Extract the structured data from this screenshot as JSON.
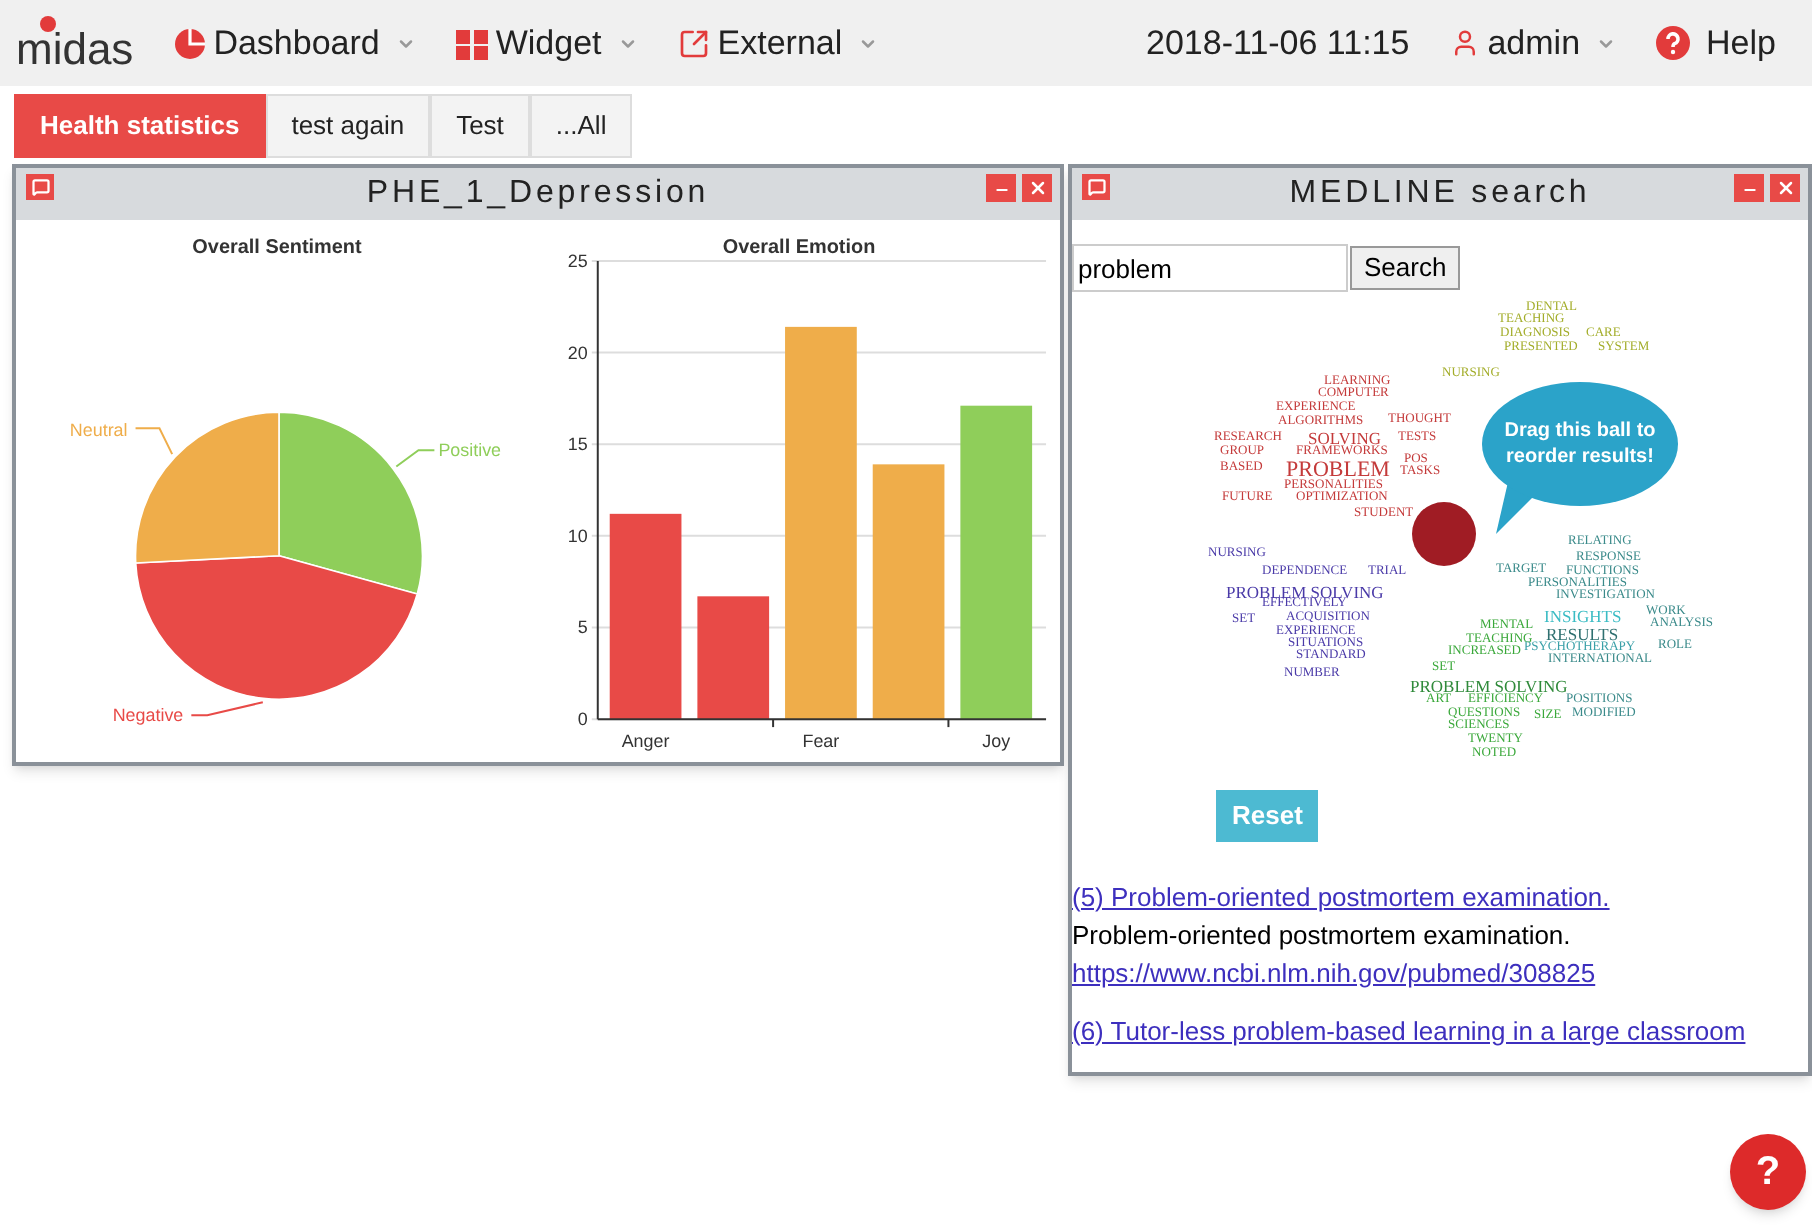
{
  "navbar": {
    "logo": "midas",
    "menus": [
      {
        "label": "Dashboard",
        "kind": "pie"
      },
      {
        "label": "Widget",
        "kind": "grid"
      },
      {
        "label": "External",
        "kind": "external"
      }
    ],
    "datetime": "2018-11-06 11:15",
    "user": "admin",
    "help": "Help"
  },
  "tabs": [
    {
      "label": "Health statistics",
      "selected": true
    },
    {
      "label": "test again",
      "selected": false
    },
    {
      "label": "Test",
      "selected": false
    },
    {
      "label": "...All",
      "selected": false
    }
  ],
  "windows": [
    {
      "title": "PHE_1_Depression",
      "kind": "charts",
      "pie": {
        "chart_data": {
          "type": "pie",
          "title": "Overall Sentiment",
          "categories": [
            "Positive",
            "Negative",
            "Neutral"
          ],
          "series": [
            {
              "values": [
                29.3,
                44.9,
                25.8
              ]
            }
          ],
          "colors": [
            "#8fce5a",
            "#e84a47",
            "#efad4a"
          ]
        }
      },
      "bar": {
        "chart_data": {
          "type": "bar",
          "title": "Overall Emotion",
          "categories": [
            "Anger",
            null,
            "Fear",
            null,
            "Joy"
          ],
          "series": [
            {
              "values": [
                11.2,
                6.7,
                21.4,
                13.9,
                17.1
              ]
            }
          ],
          "grid": true,
          "colors": [
            "#e84a47",
            "#e84a47",
            "#efad4a",
            "#efad4a",
            "#8fce5a"
          ],
          "ylim": [
            0,
            25
          ],
          "yticks": [
            0,
            5,
            10,
            15,
            20,
            25
          ]
        }
      }
    },
    {
      "title": "MEDLINE search",
      "kind": "search",
      "search": {
        "value": "problem",
        "button": "Search"
      },
      "tip": "Drag this ball to reorder results!",
      "words": [
        {
          "text": "DENTAL",
          "color": "#a3ad2a"
        },
        {
          "text": "TEACHING",
          "color": "#a3ad2a"
        },
        {
          "text": "DIAGNOSIS",
          "color": "#a3ad2a"
        },
        {
          "text": "CARE",
          "color": "#a3ad2a"
        },
        {
          "text": "PRESENTED",
          "color": "#a3ad2a"
        },
        {
          "text": "SYSTEM",
          "color": "#a3ad2a"
        },
        {
          "text": "NURSING",
          "color": "#a3ad2a"
        },
        {
          "text": "LEARNING",
          "color": "#c43a3a"
        },
        {
          "text": "COMPUTER",
          "color": "#c43a3a"
        },
        {
          "text": "EXPERIENCE",
          "color": "#c43a3a"
        },
        {
          "text": "ALGORITHMS",
          "color": "#c43a3a"
        },
        {
          "text": "THOUGHT",
          "color": "#c43a3a"
        },
        {
          "text": "RESEARCH",
          "color": "#c43a3a"
        },
        {
          "text": "SOLVING",
          "color": "#c43a3a",
          "kind": "medium"
        },
        {
          "text": "TESTS",
          "color": "#c43a3a"
        },
        {
          "text": "GROUP",
          "color": "#c43a3a"
        },
        {
          "text": "FRAMEWORKS",
          "color": "#c43a3a"
        },
        {
          "text": "POS",
          "color": "#c43a3a"
        },
        {
          "text": "BASED",
          "color": "#c43a3a"
        },
        {
          "text": "PROBLEM",
          "color": "#c43a3a",
          "kind": "large"
        },
        {
          "text": "TASKS",
          "color": "#c43a3a"
        },
        {
          "text": "PERSONALITIES",
          "color": "#c43a3a"
        },
        {
          "text": "FUTURE",
          "color": "#c43a3a"
        },
        {
          "text": "OPTIMIZATION",
          "color": "#c43a3a"
        },
        {
          "text": "STUDENT",
          "color": "#c43a3a"
        },
        {
          "text": "NURSING",
          "color": "#4a3aa8"
        },
        {
          "text": "DEPENDENCE",
          "color": "#4a3aa8"
        },
        {
          "text": "TRIAL",
          "color": "#4a3aa8"
        },
        {
          "text": "PROBLEM SOLVING",
          "color": "#4a3aa8",
          "kind": "medium"
        },
        {
          "text": "EFFECTIVELY",
          "color": "#4a3aa8"
        },
        {
          "text": "SET",
          "color": "#4a3aa8"
        },
        {
          "text": "ACQUISITION",
          "color": "#4a3aa8"
        },
        {
          "text": "EXPERIENCE",
          "color": "#4a3aa8"
        },
        {
          "text": "SITUATIONS",
          "color": "#4a3aa8"
        },
        {
          "text": "STANDARD",
          "color": "#4a3aa8"
        },
        {
          "text": "NUMBER",
          "color": "#4a3aa8"
        },
        {
          "text": "RELATING",
          "color": "#3a8a8a"
        },
        {
          "text": "RESPONSE",
          "color": "#3a8a8a"
        },
        {
          "text": "TARGET",
          "color": "#3a8a8a"
        },
        {
          "text": "FUNCTIONS",
          "color": "#3a8a8a"
        },
        {
          "text": "PERSONALITIES",
          "color": "#3a8a8a"
        },
        {
          "text": "INVESTIGATION",
          "color": "#3a8a8a"
        },
        {
          "text": "INSIGHTS",
          "color": "#3bbcc4",
          "kind": "medium"
        },
        {
          "text": "WORK",
          "color": "#3a8a8a"
        },
        {
          "text": "ANALYSIS",
          "color": "#3a8a8a"
        },
        {
          "text": "RESULTS",
          "color": "#2f7070",
          "kind": "medium"
        },
        {
          "text": "PSYCHOTHERAPY",
          "color": "#3aa0a8"
        },
        {
          "text": "ROLE",
          "color": "#3a8a8a"
        },
        {
          "text": "INTERNATIONAL",
          "color": "#3a8a8a"
        },
        {
          "text": "POSITIONS",
          "color": "#3a8a8a"
        },
        {
          "text": "MODIFIED",
          "color": "#3a8a8a"
        },
        {
          "text": "MENTAL",
          "color": "#3aa83a"
        },
        {
          "text": "TEACHING",
          "color": "#3aa83a"
        },
        {
          "text": "INCREASED",
          "color": "#3aa83a"
        },
        {
          "text": "SET",
          "color": "#3aa83a"
        },
        {
          "text": "PROBLEM SOLVING",
          "color": "#2f8a3a",
          "kind": "medium"
        },
        {
          "text": "ART",
          "color": "#3aa83a"
        },
        {
          "text": "EFFICIENCY",
          "color": "#3aa83a"
        },
        {
          "text": "QUESTIONS",
          "color": "#3aa83a"
        },
        {
          "text": "SIZE",
          "color": "#3aa83a"
        },
        {
          "text": "SCIENCES",
          "color": "#3aa83a"
        },
        {
          "text": "TWENTY",
          "color": "#3aa83a"
        },
        {
          "text": "NOTED",
          "color": "#3aa83a"
        }
      ],
      "reset": "Reset",
      "results": [
        {
          "title": "(5) Problem-oriented postmortem examination.",
          "summary": "Problem-oriented postmortem examination.",
          "url": "https://www.ncbi.nlm.nih.gov/pubmed/308825"
        },
        {
          "title": "(6) Tutor-less problem-based learning in a large classroom"
        }
      ]
    }
  ],
  "help_button": "?"
}
